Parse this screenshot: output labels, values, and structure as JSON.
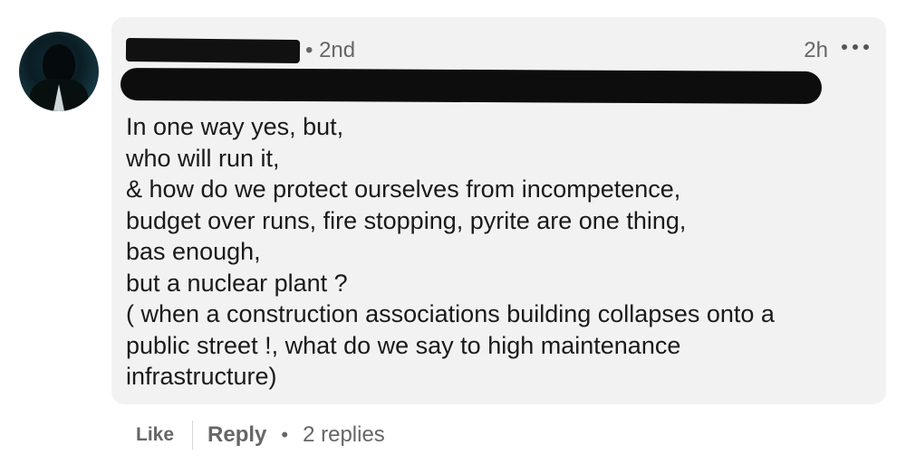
{
  "comment": {
    "author": {
      "connection_degree": "• 2nd"
    },
    "timestamp": "2h",
    "more_icon": "ellipsis-horizontal-icon",
    "body_lines": [
      "In one way yes, but,",
      "who will run it,",
      "& how do we protect ourselves from incompetence,",
      "budget over runs, fire stopping, pyrite are one thing,",
      "bas enough,",
      "but a nuclear plant ?",
      "( when a construction associations building collapses onto a",
      "public street !, what do we say to high maintenance",
      "infrastructure)"
    ]
  },
  "actions": {
    "like_label": "Like",
    "reply_label": "Reply",
    "separator": "•",
    "replies_label": "2 replies"
  },
  "colors": {
    "bubble_bg": "#f2f2f2",
    "meta_text": "#666666",
    "body_text": "#1a1a1a"
  }
}
